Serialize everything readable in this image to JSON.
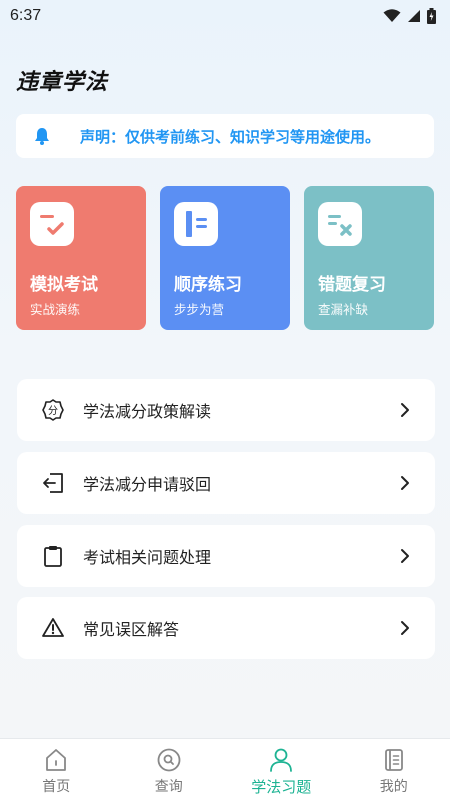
{
  "status_bar": {
    "time": "6:37"
  },
  "page_title": "违章学法",
  "notice": {
    "text": "声明：仅供考前练习、知识学习等用途使用。"
  },
  "cards": [
    {
      "title": "模拟考试",
      "subtitle": "实战演练",
      "color": "#ef7b6f",
      "icon": "exam-icon"
    },
    {
      "title": "顺序练习",
      "subtitle": "步步为营",
      "color": "#5b8ff3",
      "icon": "notebook-icon"
    },
    {
      "title": "错题复习",
      "subtitle": "查漏补缺",
      "color": "#7cc0c6",
      "icon": "wrong-answer-icon"
    }
  ],
  "menu": [
    {
      "label": "学法减分政策解读",
      "icon": "points-badge-icon"
    },
    {
      "label": "学法减分申请驳回",
      "icon": "return-icon"
    },
    {
      "label": "考试相关问题处理",
      "icon": "clipboard-icon"
    },
    {
      "label": "常见误区解答",
      "icon": "warning-icon"
    }
  ],
  "tabs": [
    {
      "label": "首页",
      "icon": "home-icon",
      "active": false
    },
    {
      "label": "查询",
      "icon": "search-icon",
      "active": false
    },
    {
      "label": "学法习题",
      "icon": "user-icon",
      "active": true
    },
    {
      "label": "我的",
      "icon": "profile-book-icon",
      "active": false
    }
  ],
  "colors": {
    "accent": "#1db393",
    "notice_text": "#2196f3",
    "inactive_tab": "#777777"
  }
}
